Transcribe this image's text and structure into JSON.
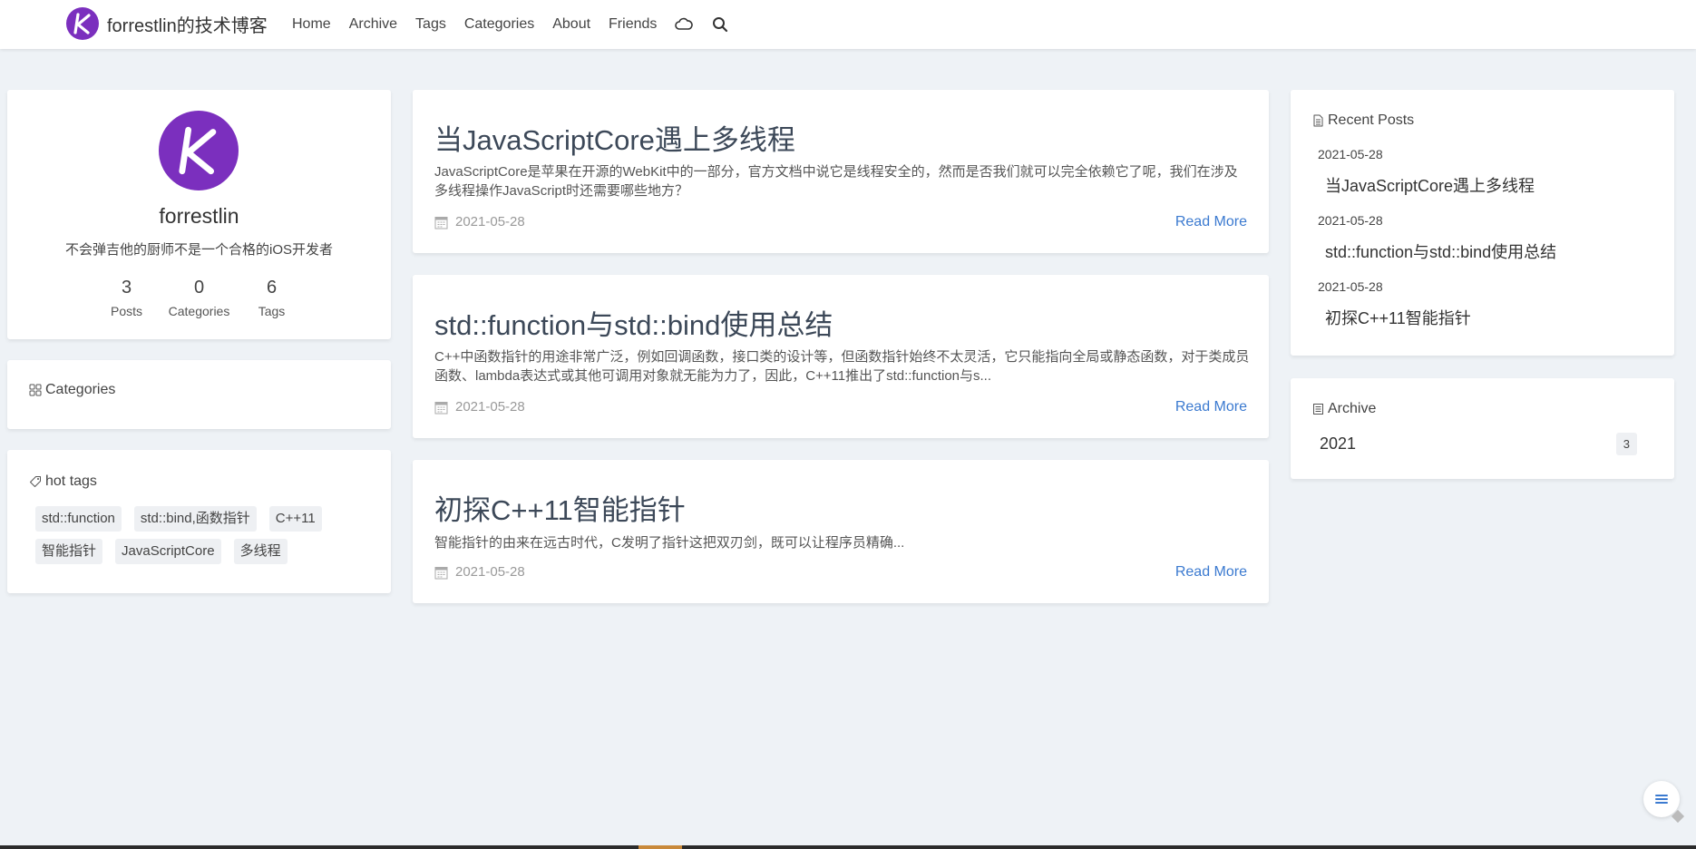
{
  "header": {
    "brand": "forrestlin的技术博客",
    "nav": [
      "Home",
      "Archive",
      "Tags",
      "Categories",
      "About",
      "Friends"
    ]
  },
  "profile": {
    "name": "forrestlin",
    "description": "不会弹吉他的厨师不是一个合格的iOS开发者",
    "stats": [
      {
        "value": "3",
        "label": "Posts"
      },
      {
        "value": "0",
        "label": "Categories"
      },
      {
        "value": "6",
        "label": "Tags"
      }
    ]
  },
  "categories": {
    "title": "Categories"
  },
  "hot_tags": {
    "title": "hot tags",
    "tags": [
      "std::function",
      "std::bind,函数指针",
      "C++11",
      "智能指针",
      "JavaScriptCore",
      "多线程"
    ]
  },
  "posts": [
    {
      "title": "当JavaScriptCore遇上多线程",
      "excerpt": "JavaScriptCore是苹果在开源的WebKit中的一部分，官方文档中说它是线程安全的，然而是否我们就可以完全依赖它了呢，我们在涉及多线程操作JavaScript时还需要哪些地方？",
      "date": "2021-05-28",
      "read_more": "Read More"
    },
    {
      "title": "std::function与std::bind使用总结",
      "excerpt": "C++中函数指针的用途非常广泛，例如回调函数，接口类的设计等，但函数指针始终不太灵活，它只能指向全局或静态函数，对于类成员函数、lambda表达式或其他可调用对象就无能为力了，因此，C++11推出了std::function与s...",
      "date": "2021-05-28",
      "read_more": "Read More"
    },
    {
      "title": "初探C++11智能指针",
      "excerpt": "智能指针的由来在远古时代，C发明了指针这把双刃剑，既可以让程序员精确...",
      "date": "2021-05-28",
      "read_more": "Read More"
    }
  ],
  "recent_posts": {
    "title": "Recent Posts",
    "items": [
      {
        "date": "2021-05-28",
        "title": "当JavaScriptCore遇上多线程"
      },
      {
        "date": "2021-05-28",
        "title": "std::function与std::bind使用总结"
      },
      {
        "date": "2021-05-28",
        "title": "初探C++11智能指针"
      }
    ]
  },
  "archive": {
    "title": "Archive",
    "items": [
      {
        "year": "2021",
        "count": "3"
      }
    ]
  },
  "colors": {
    "accent": "#3b7ad0",
    "brand": "#7b2fbe",
    "background": "#eef2f6"
  },
  "icons": [
    "cloud-icon",
    "search-icon",
    "calendar-icon",
    "grid-icon",
    "tag-icon",
    "document-icon",
    "list-icon"
  ]
}
